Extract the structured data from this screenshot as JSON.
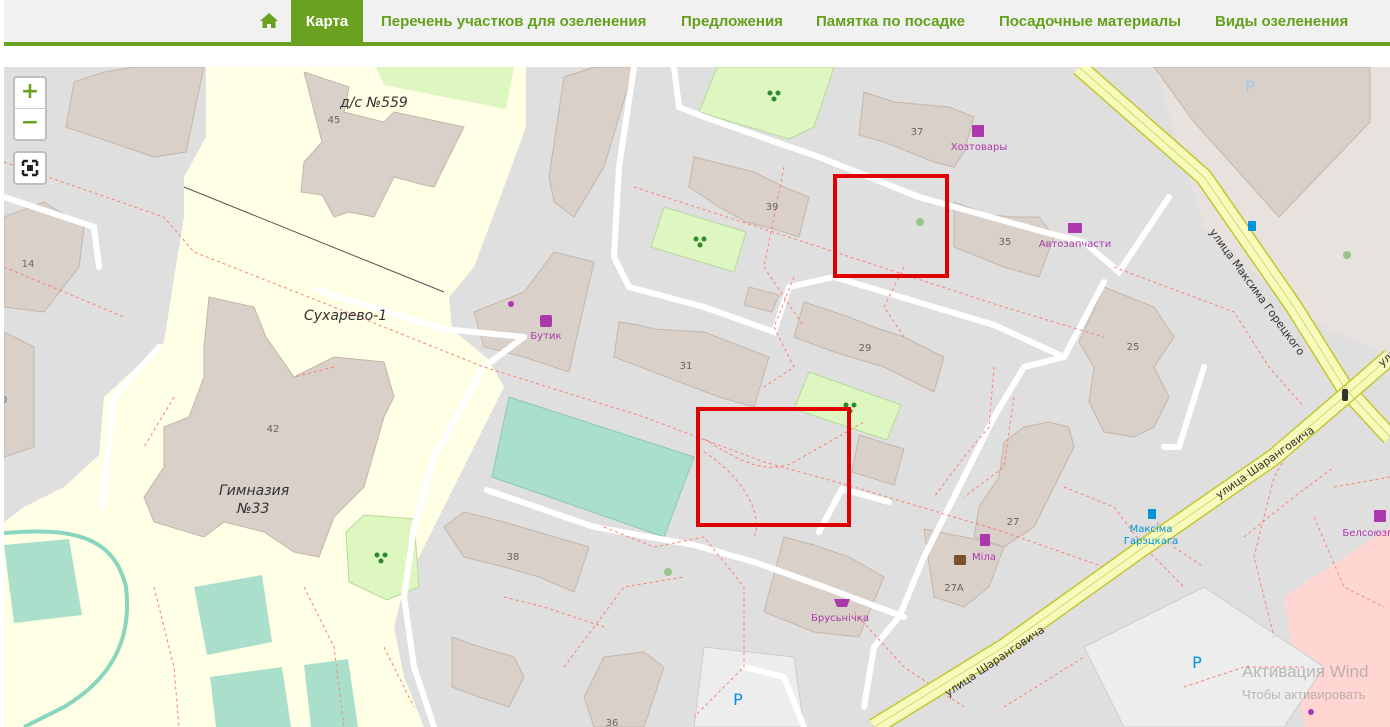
{
  "nav": {
    "home_icon": "home-icon",
    "items": [
      {
        "label": "Карта",
        "active": true
      },
      {
        "label": "Перечень участков для озеленения",
        "active": false
      },
      {
        "label": "Предложения",
        "active": false
      },
      {
        "label": "Памятка по посадке",
        "active": false
      },
      {
        "label": "Посадочные материалы",
        "active": false
      },
      {
        "label": "Виды озеленения",
        "active": false
      }
    ],
    "accent_color": "#6aa121"
  },
  "map_controls": {
    "zoom_in": "+",
    "zoom_out": "−",
    "fullscreen_icon": "fullscreen-icon"
  },
  "map": {
    "labels": {
      "kindergarten": "д/с №559",
      "suburb": "Сухарево-1",
      "school_line1": "Гимназия",
      "school_line2": "№33",
      "street_horetsky": "улица Максима Горецкого",
      "street_sharangovicha_1": "улица Шаранговича",
      "street_sharangovicha_2": "улица Шаранговича",
      "street_edge": "ули",
      "stop_line1": "Максіма",
      "stop_line2": "Гарэцкага",
      "belsoyuz": "Белсоюзп"
    },
    "pois": {
      "hoztovary": "Хозтовары",
      "autoparts": "Автозапчасти",
      "boutique": "Бутик",
      "mila": "Міла",
      "brusnichka": "Брусьнічка"
    },
    "house_numbers": {
      "h45": "45",
      "h14": "14",
      "h42": "42",
      "h0": "0",
      "h39": "39",
      "h37": "37",
      "h35": "35",
      "h31": "31",
      "h29": "29",
      "h25": "25",
      "h27": "27",
      "h27a": "27А",
      "h38": "38",
      "h36": "36"
    },
    "parking": {
      "p1": "P",
      "p2": "P",
      "p3": "P"
    },
    "colors": {
      "background": "#e0dfdf",
      "school_area": "#ffffe5",
      "building": "#d9d0c9",
      "park": "#def6c0",
      "pitch": "#aae0cb",
      "road_primary": "#f6fabb",
      "road_casing": "#c3c72f",
      "footway": "#fa8072",
      "highlight": "#e10000"
    }
  },
  "watermark": {
    "line1": "Активация Wind",
    "line2": "Чтобы активировать"
  }
}
